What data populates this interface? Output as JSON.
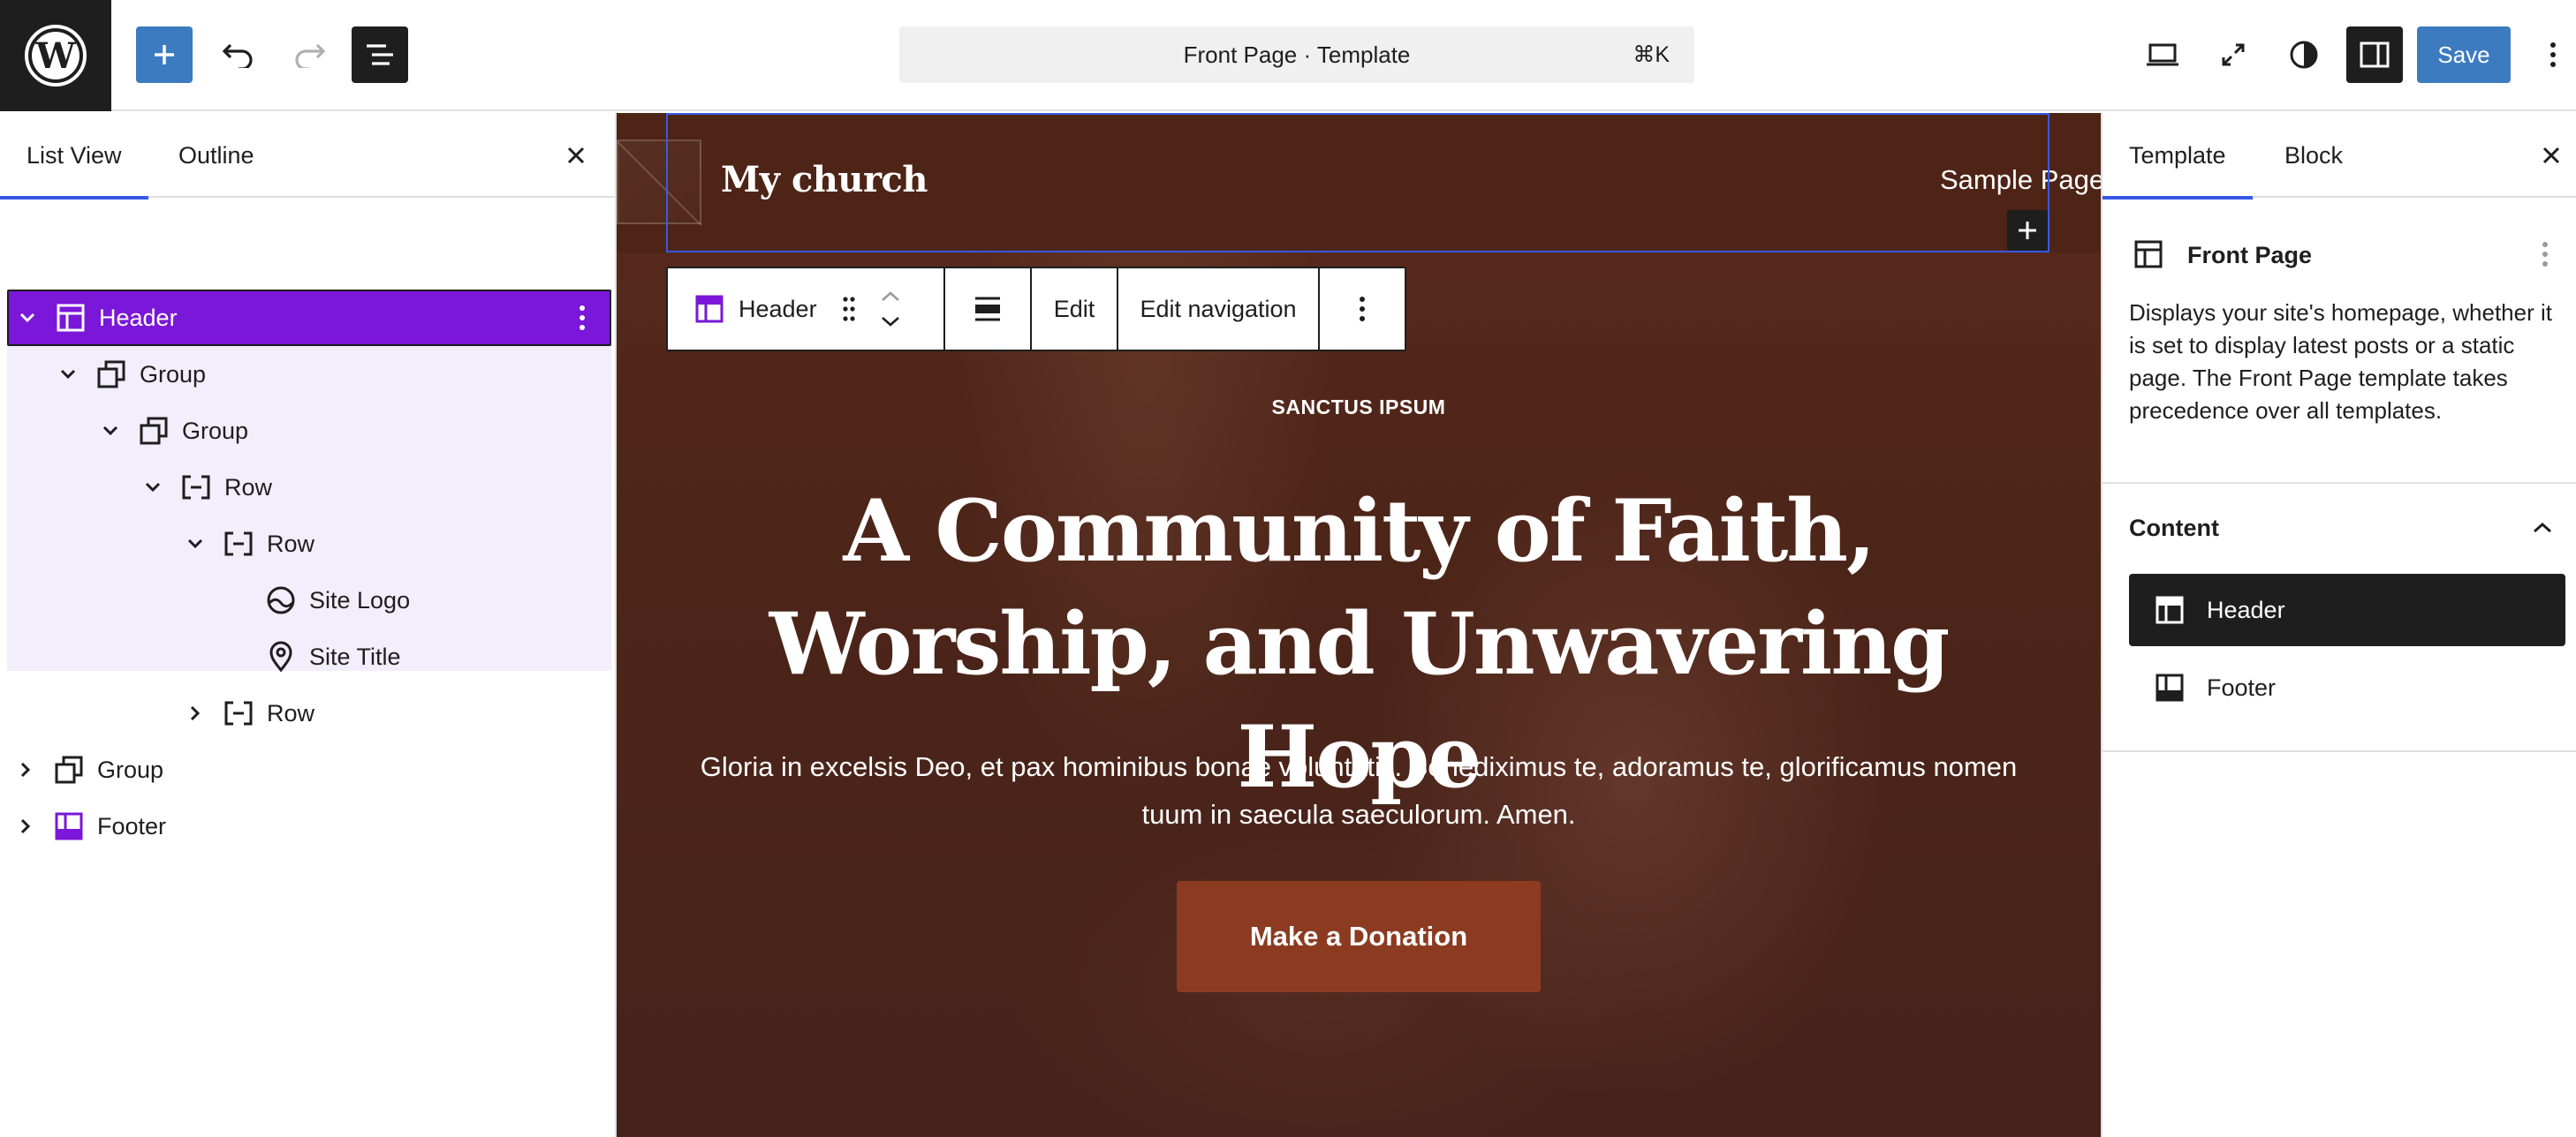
{
  "topbar": {
    "command_title": "Front Page · Template",
    "command_shortcut": "⌘K",
    "save_label": "Save"
  },
  "left_panel": {
    "tabs": [
      {
        "label": "List View",
        "active": true
      },
      {
        "label": "Outline",
        "active": false
      }
    ],
    "tree": [
      {
        "label": "Header",
        "icon": "template-part-header-icon",
        "expanded": true,
        "selected": true
      },
      {
        "label": "Group",
        "icon": "group-icon",
        "expanded": true
      },
      {
        "label": "Group",
        "icon": "group-icon",
        "expanded": true
      },
      {
        "label": "Row",
        "icon": "row-icon",
        "expanded": true
      },
      {
        "label": "Row",
        "icon": "row-icon",
        "expanded": true
      },
      {
        "label": "Site Logo",
        "icon": "site-logo-icon"
      },
      {
        "label": "Site Title",
        "icon": "map-marker-icon"
      },
      {
        "label": "Row",
        "icon": "row-icon",
        "expanded": false
      },
      {
        "label": "Group",
        "icon": "group-icon",
        "expanded": false
      },
      {
        "label": "Footer",
        "icon": "template-part-footer-icon",
        "expanded": false
      }
    ]
  },
  "canvas": {
    "site_title": "My church",
    "nav_link": "Sample Page",
    "block_toolbar": {
      "block_name": "Header",
      "edit_label": "Edit",
      "edit_navigation_label": "Edit navigation"
    },
    "eyebrow": "SANCTUS IPSUM",
    "hero_title": "A Community of Faith, Worship, and Unwavering Hope",
    "hero_text": "Gloria in excelsis Deo, et pax hominibus bonae voluntatis. Benediximus te, adoramus te, glorificamus nomen tuum in saecula saeculorum. Amen.",
    "donate_label": "Make a Donation"
  },
  "right_panel": {
    "tabs": [
      {
        "label": "Template",
        "active": true
      },
      {
        "label": "Block",
        "active": false
      }
    ],
    "template_name": "Front Page",
    "template_description": "Displays your site's homepage, whether it is set to display latest posts or a static page. The Front Page template takes precedence over all templates.",
    "content_title": "Content",
    "parts": [
      {
        "label": "Header",
        "active": true
      },
      {
        "label": "Footer",
        "active": false
      }
    ]
  },
  "colors": {
    "accent": "#3858e9",
    "save_blue": "#3c7bbf",
    "selection_purple": "#7a17d8",
    "hero_brown": "#4a2318",
    "donate": "#8c3b20"
  }
}
